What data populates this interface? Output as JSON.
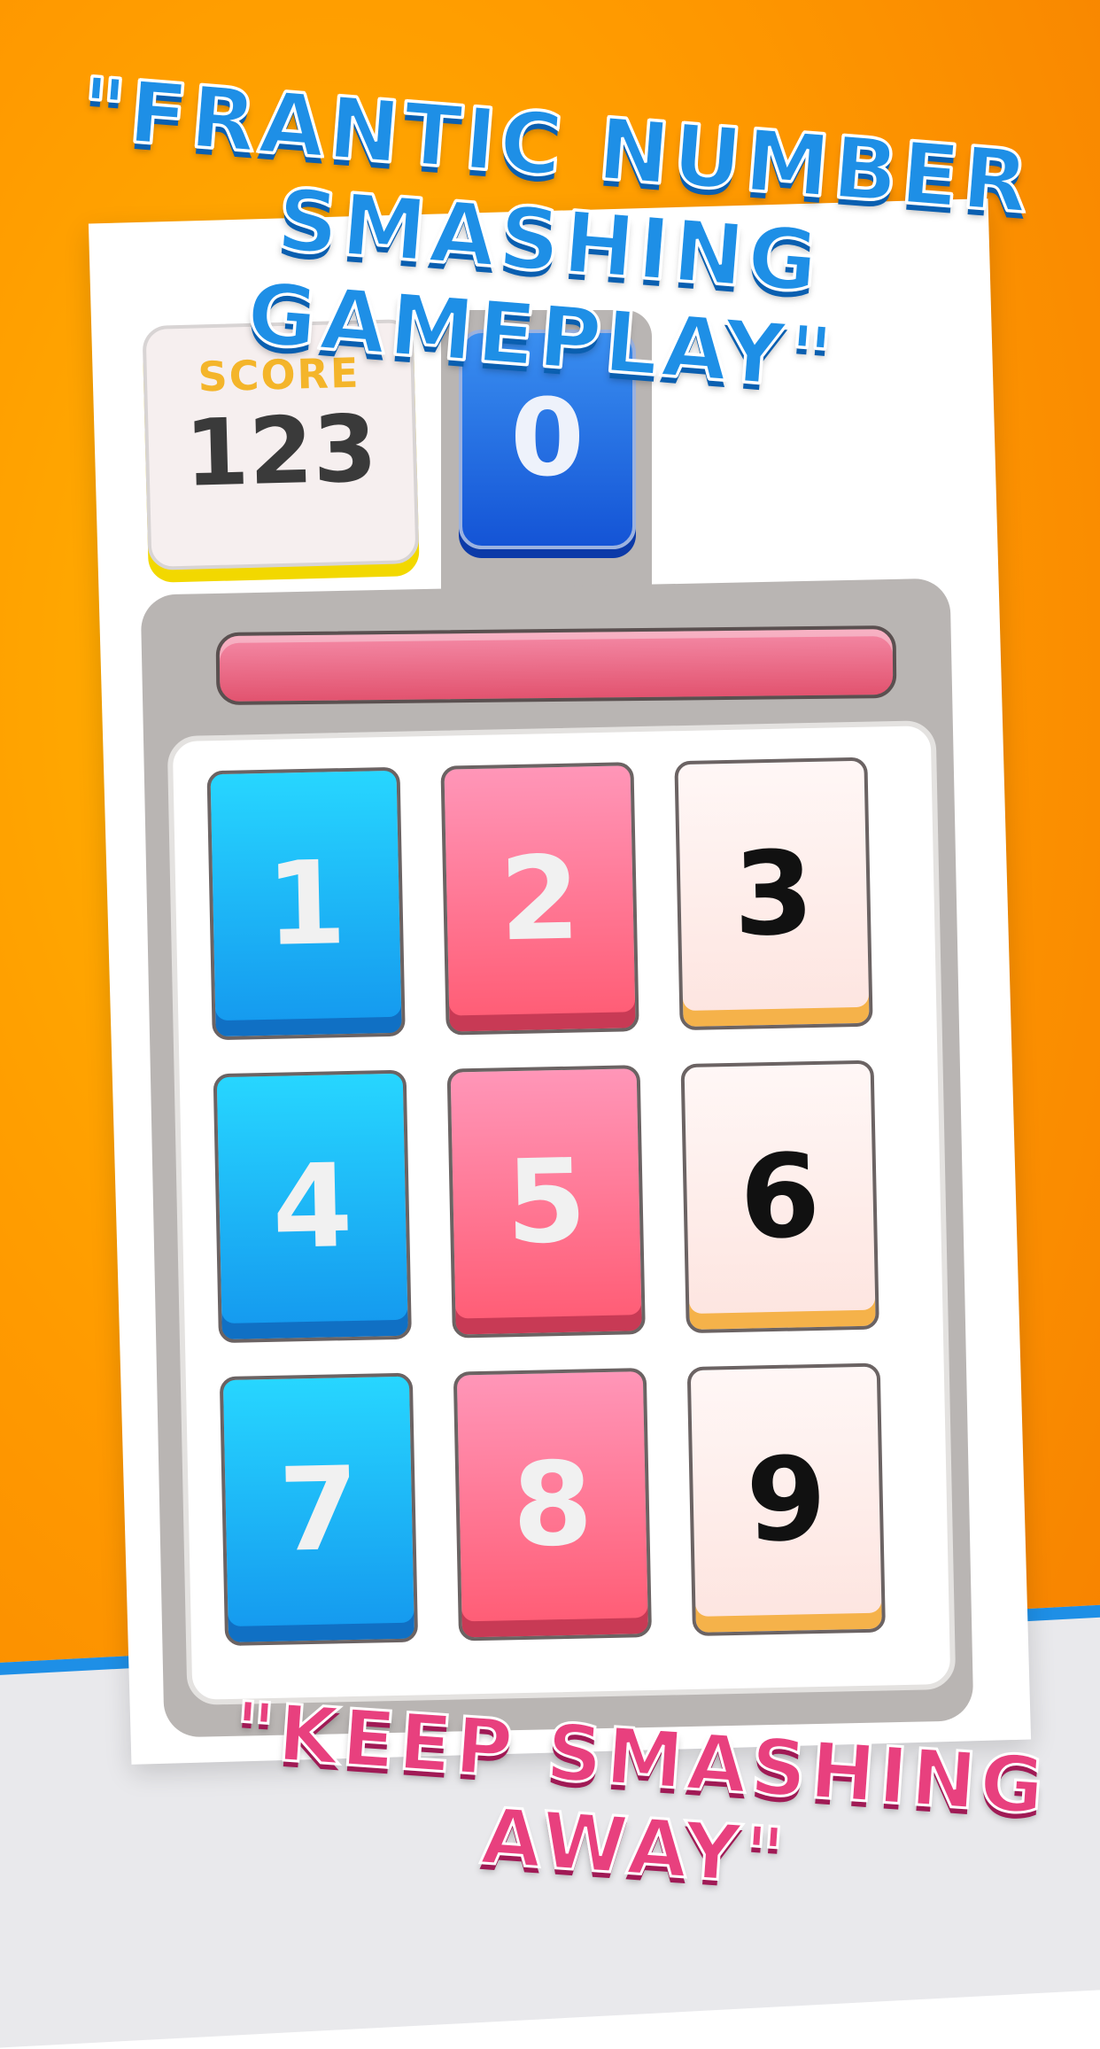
{
  "headline_top": "\"FRANTIC NUMBER SMASHING GAMEPLAY\"",
  "headline_bottom": "\"KEEP SMASHING AWAY\"",
  "score": {
    "label": "SCORE",
    "value": "123"
  },
  "counter": {
    "value": "0"
  },
  "timer": {
    "fill": 1.0
  },
  "tiles": [
    "1",
    "2",
    "3",
    "4",
    "5",
    "6",
    "7",
    "8",
    "9"
  ],
  "colors": {
    "blue": "#1e8fe6",
    "pink": "#e8407e",
    "orange": "#ff9a00"
  }
}
